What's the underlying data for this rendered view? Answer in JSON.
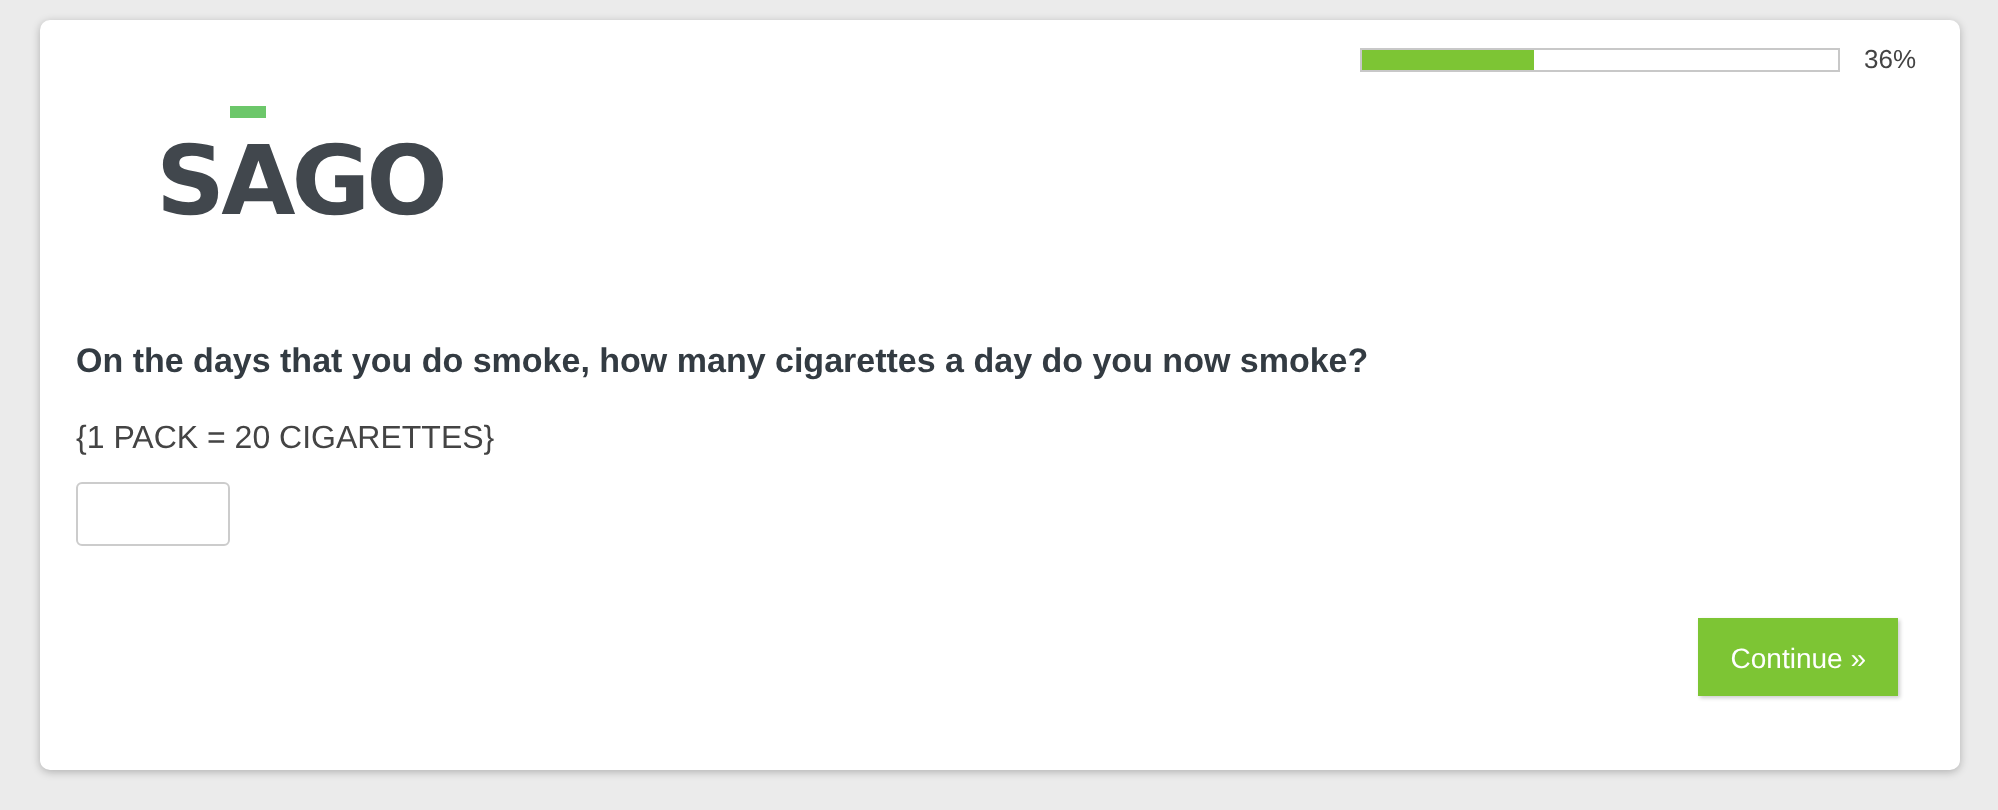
{
  "progress": {
    "level": 0.36,
    "reading": "36%"
  },
  "logo": {
    "text": "SAGO"
  },
  "question": {
    "text": "On the days that you do smoke, how many cigarettes a day do you now smoke?",
    "note": "{1 PACK = 20 CIGARETTES}"
  },
  "buttons": [
    {
      "label": "Continue »"
    }
  ]
}
